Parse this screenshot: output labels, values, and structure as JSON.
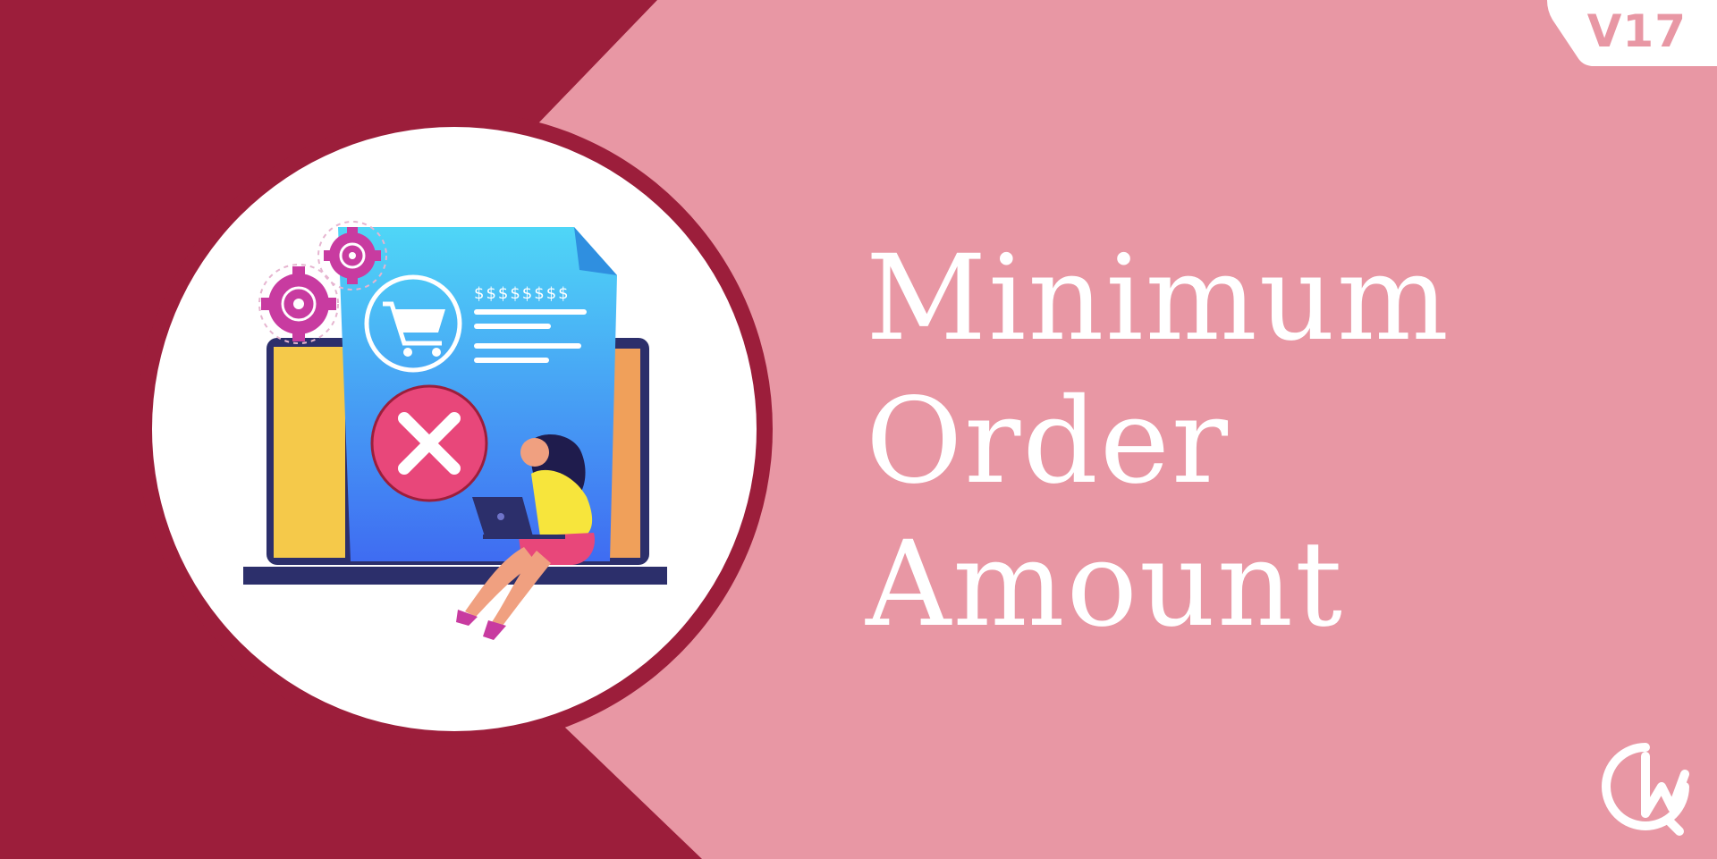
{
  "banner": {
    "version_badge": "V17",
    "title_lines": [
      "Minimum",
      "Order",
      "Amount"
    ],
    "price_row": "$$$$$$$$"
  },
  "colors": {
    "left_panel": "#9c1e3b",
    "right_panel": "#e897a4",
    "circle_fill": "#ffffff",
    "circle_ring": "#8f1a36",
    "title_text": "#ffffff",
    "badge_bg": "#ffffff",
    "badge_text": "#e897a4"
  },
  "icons": {
    "illustration": "invoice-rejected-illustration",
    "gear": "gear-icon",
    "cart": "shopping-cart-icon",
    "reject": "close-x-icon",
    "logo": "brand-logo-icon"
  }
}
